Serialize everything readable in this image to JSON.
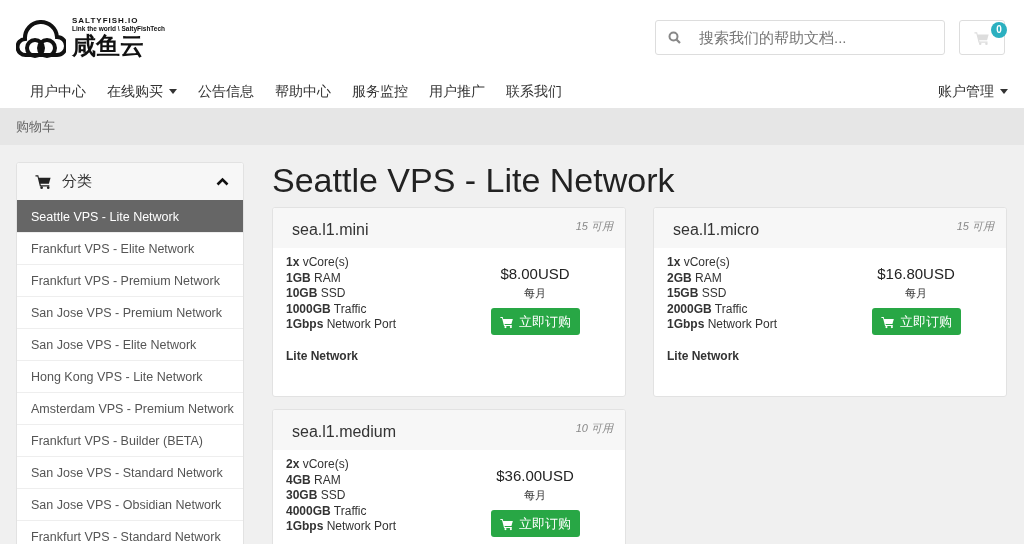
{
  "logo": {
    "name": "SALTYFISH.IO",
    "tagline": "Link the world \\ SaltyFishTech",
    "brand": "咸鱼云"
  },
  "search": {
    "placeholder": "搜索我们的帮助文档..."
  },
  "cart": {
    "count": "0"
  },
  "nav": [
    {
      "label": "用户中心",
      "dropdown": false
    },
    {
      "label": "在线购买",
      "dropdown": true
    },
    {
      "label": "公告信息",
      "dropdown": false
    },
    {
      "label": "帮助中心",
      "dropdown": false
    },
    {
      "label": "服务监控",
      "dropdown": false
    },
    {
      "label": "用户推广",
      "dropdown": false
    },
    {
      "label": "联系我们",
      "dropdown": false
    }
  ],
  "account": {
    "label": "账户管理",
    "dropdown": true
  },
  "breadcrumb": "购物车",
  "sidebar": {
    "title": "分类",
    "expanded": true,
    "items": [
      {
        "label": "Seattle VPS - Lite Network",
        "selected": true
      },
      {
        "label": "Frankfurt VPS - Elite Network",
        "selected": false
      },
      {
        "label": "Frankfurt VPS - Premium Network",
        "selected": false
      },
      {
        "label": "San Jose VPS - Premium Network",
        "selected": false
      },
      {
        "label": "San Jose VPS - Elite Network",
        "selected": false
      },
      {
        "label": "Hong Kong VPS - Lite Network",
        "selected": false
      },
      {
        "label": "Amsterdam VPS - Premium Network",
        "selected": false
      },
      {
        "label": "Frankfurt VPS - Builder (BETA)",
        "selected": false
      },
      {
        "label": "San Jose VPS - Standard Network",
        "selected": false
      },
      {
        "label": "San Jose VPS - Obsidian Network",
        "selected": false
      },
      {
        "label": "Frankfurt VPS - Standard Network",
        "selected": false
      }
    ]
  },
  "page_title": "Seattle VPS - Lite Network",
  "products": [
    {
      "name": "sea.l1.mini",
      "stock": "15 可用",
      "features": [
        "**1x** vCore(s)",
        "**1GB** RAM",
        "**10GB** SSD",
        "**1000GB** Traffic",
        "**1Gbps** Network Port"
      ],
      "group": "Lite Network",
      "price": "$8.00USD",
      "cycle": "每月",
      "button": "立即订购"
    },
    {
      "name": "sea.l1.micro",
      "stock": "15 可用",
      "features": [
        "**1x** vCore(s)",
        "**2GB** RAM",
        "**15GB** SSD",
        "**2000GB** Traffic",
        "**1Gbps** Network Port"
      ],
      "group": "Lite Network",
      "price": "$16.80USD",
      "cycle": "每月",
      "button": "立即订购"
    },
    {
      "name": "sea.l1.medium",
      "stock": "10 可用",
      "features": [
        "**2x** vCore(s)",
        "**4GB** RAM",
        "**30GB** SSD",
        "**4000GB** Traffic",
        "**1Gbps** Network Port"
      ],
      "price": "$36.00USD",
      "cycle": "每月",
      "button": "立即订购"
    }
  ]
}
